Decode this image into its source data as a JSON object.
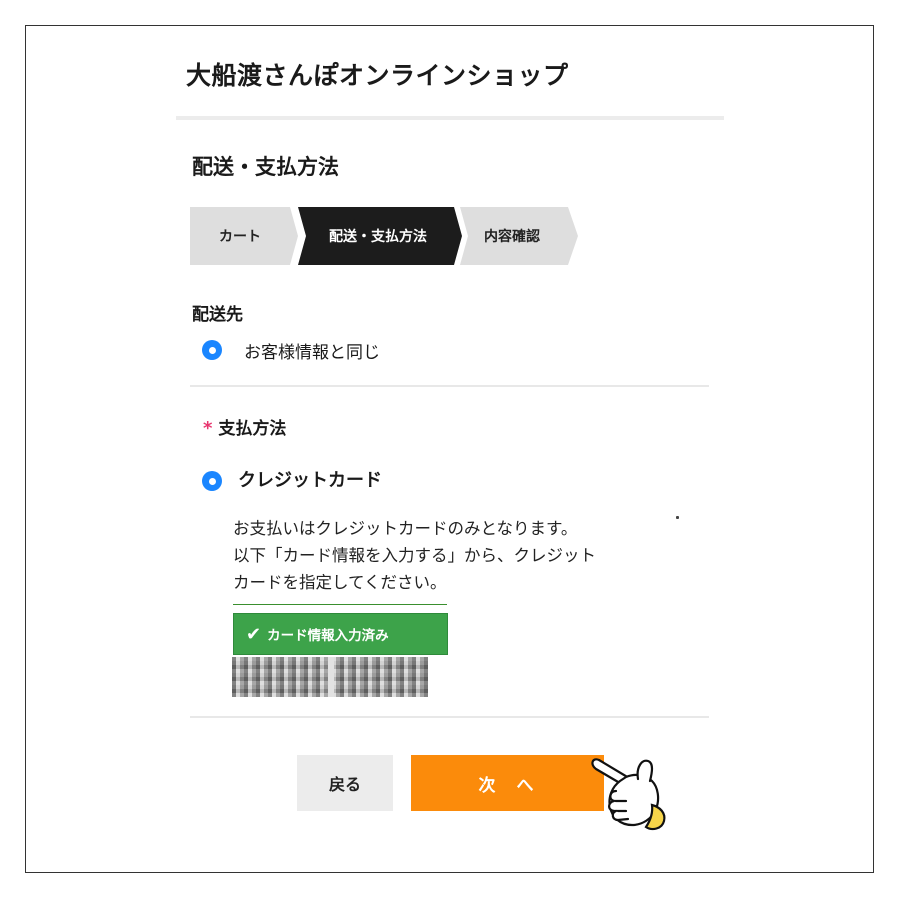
{
  "shop_title": "大船渡さんぽオンラインショップ",
  "page_heading": "配送・支払方法",
  "steps": [
    {
      "label": "カート",
      "state": "done"
    },
    {
      "label": "配送・支払方法",
      "state": "current"
    },
    {
      "label": "内容確認",
      "state": "upcoming"
    }
  ],
  "shipping": {
    "label": "配送先",
    "option": "お客様情報と同じ",
    "selected": true
  },
  "payment": {
    "required_mark": "*",
    "label": "支払方法",
    "option": "クレジットカード",
    "selected": true,
    "description_lines": [
      "お支払いはクレジットカードのみとなります。",
      "以下「カード情報を入力する」から、クレジット",
      "カードを指定してください。"
    ],
    "card_badge": "カード情報入力済み",
    "card_badge_icon": "check-icon"
  },
  "buttons": {
    "back": "戻る",
    "next_part1": "次",
    "next_part2": "へ"
  },
  "colors": {
    "radio": "#1a86ff",
    "next_button": "#fb8b0b",
    "badge": "#3da34a",
    "required": "#e8366f",
    "active_step": "#1c1c1c"
  }
}
